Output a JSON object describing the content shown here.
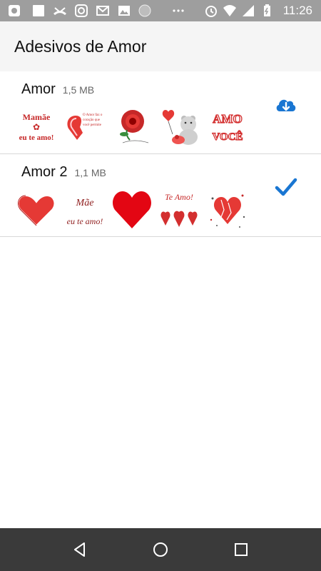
{
  "status_bar": {
    "time": "11:26",
    "left_icons": [
      "app-icon",
      "app-icon-2",
      "missed-call-icon",
      "instagram-icon",
      "gmail-icon",
      "image-icon",
      "circle-icon",
      "more-icon"
    ],
    "right_icons": [
      "alarm-icon",
      "wifi-icon",
      "signal-icon",
      "battery-charging-icon"
    ]
  },
  "app_bar": {
    "title": "Adesivos de Amor"
  },
  "packs": [
    {
      "name": "Amor",
      "size": "1,5 MB",
      "action": "download",
      "stickers": [
        "sticker-mamae-eu-te-amo",
        "sticker-heart-text",
        "sticker-rose",
        "sticker-teddy-bear",
        "sticker-amo-voce"
      ]
    },
    {
      "name": "Amor 2",
      "size": "1,1 MB",
      "action": "installed",
      "stickers": [
        "sticker-red-heart",
        "sticker-mae-eu-te-amo",
        "sticker-big-heart",
        "sticker-te-amo-hearts",
        "sticker-sparkle-heart"
      ]
    }
  ],
  "sticker_texts": {
    "mamae_line1": "Mamãe",
    "mamae_line2": "eu te amo!",
    "heart_text": "O Amor faz o coração que você permite",
    "amo": "AMO",
    "voce": "VOCÊ",
    "mae": "Mãe",
    "eu_te_amo": "eu te amo!",
    "te_amo": "Te Amo!"
  },
  "colors": {
    "accent_blue": "#1976d2",
    "heart_red": "#e30613"
  }
}
